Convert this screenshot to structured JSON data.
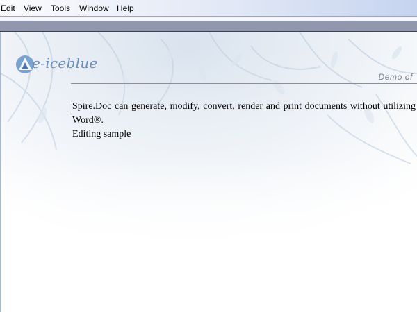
{
  "menubar": {
    "items": [
      {
        "label": "Edit",
        "mnemonic": "E"
      },
      {
        "label": "View",
        "mnemonic": "V"
      },
      {
        "label": "Tools",
        "mnemonic": "T"
      },
      {
        "label": "Window",
        "mnemonic": "W"
      },
      {
        "label": "Help",
        "mnemonic": "H"
      }
    ]
  },
  "header": {
    "logo_text": "e-iceblue",
    "demo_label": "Demo of"
  },
  "document": {
    "paragraphs": [
      "Spire.Doc can generate, modify, convert, render and print documents without utilizing Word®.",
      "Editing sample"
    ]
  },
  "colors": {
    "menubar_end": "#c6d4f0",
    "ruler_bar": "#9197ad",
    "logo_blue": "#6b90bb"
  }
}
